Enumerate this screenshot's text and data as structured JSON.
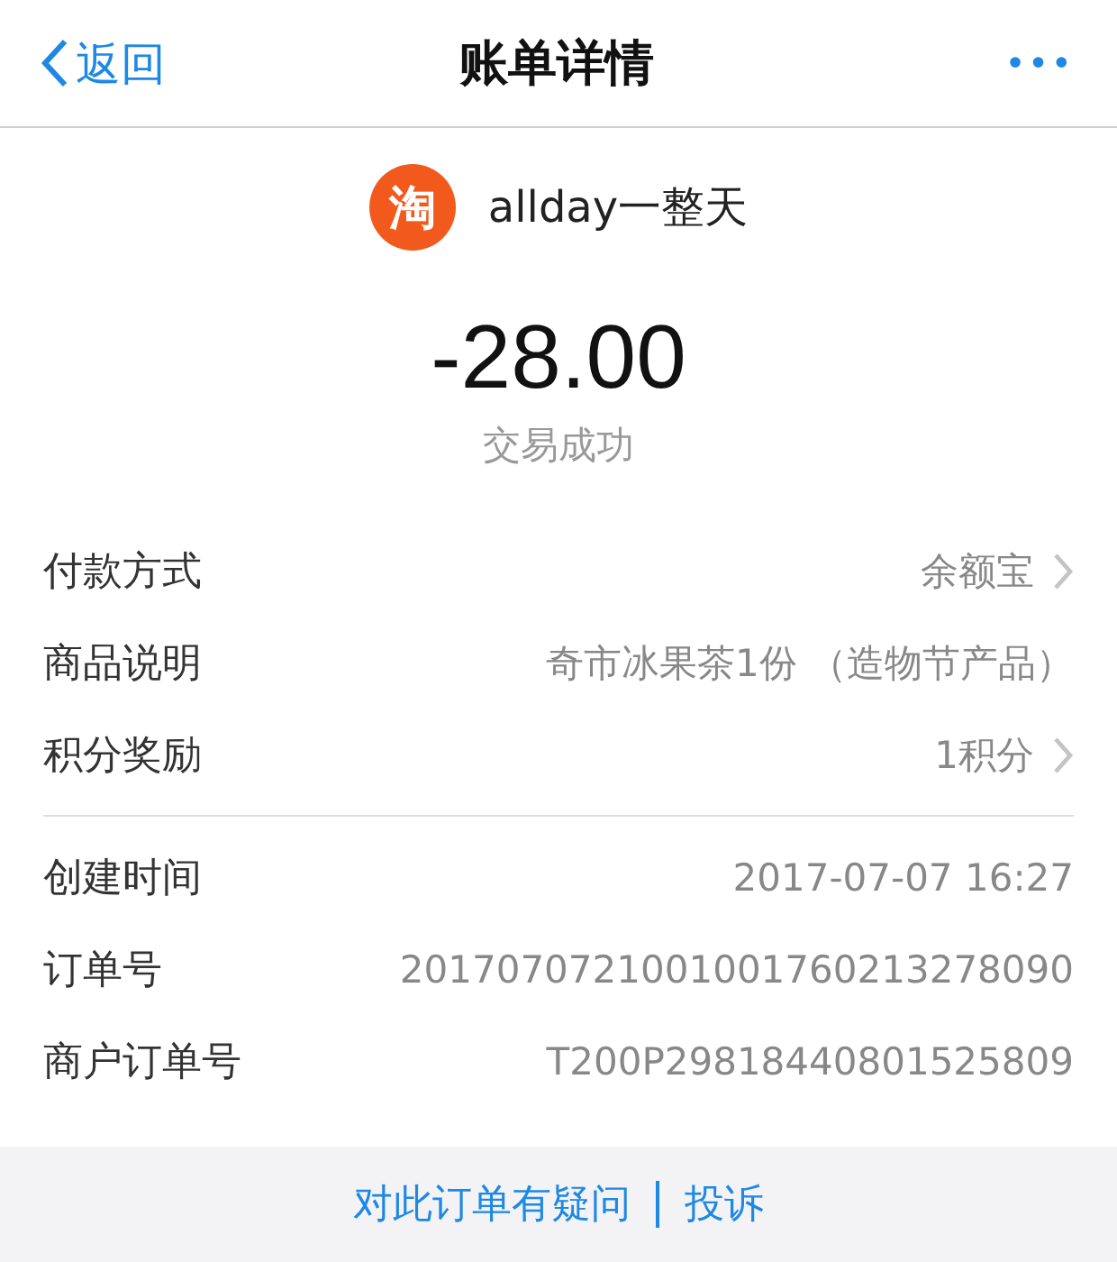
{
  "nav": {
    "back": "返回",
    "title": "账单详情",
    "more": "•••"
  },
  "merchant": {
    "logo": "淘",
    "name": "allday一整天"
  },
  "amount": "-28.00",
  "status": "交易成功",
  "sections": [
    {
      "rows": [
        {
          "label": "付款方式",
          "value": "余额宝",
          "kind": "link"
        },
        {
          "label": "商品说明",
          "value": "奇市冰果茶1份 （造物节产品）",
          "kind": "plain"
        },
        {
          "label": "积分奖励",
          "value": "1积分",
          "kind": "link"
        }
      ]
    },
    {
      "rows": [
        {
          "label": "创建时间",
          "value": "2017-07-07 16:27",
          "kind": "plain"
        },
        {
          "label": "订单号",
          "value": "2017070721001001760213278090",
          "kind": "plain"
        },
        {
          "label": "商户订单号",
          "value": "T200P29818440801525809",
          "kind": "plain"
        }
      ]
    }
  ],
  "footer": {
    "question": "对此订单有疑问",
    "complaint": "投诉"
  }
}
